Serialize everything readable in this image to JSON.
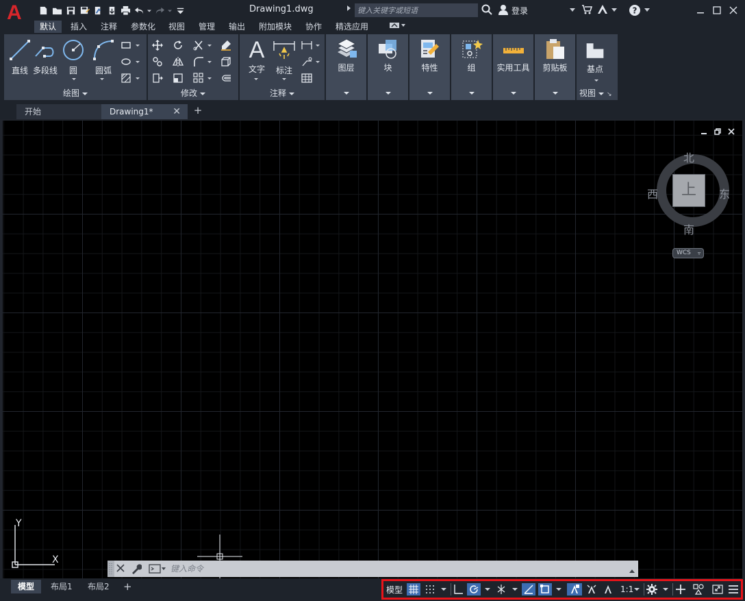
{
  "titlebar": {
    "document_title": "Drawing1.dwg",
    "search_placeholder": "键入关键字或短语",
    "login_label": "登录"
  },
  "ribbon_tabs": [
    {
      "label": "默认",
      "active": true
    },
    {
      "label": "插入"
    },
    {
      "label": "注释"
    },
    {
      "label": "参数化"
    },
    {
      "label": "视图"
    },
    {
      "label": "管理"
    },
    {
      "label": "输出"
    },
    {
      "label": "附加模块"
    },
    {
      "label": "协作"
    },
    {
      "label": "精选应用"
    }
  ],
  "panels": {
    "draw": {
      "title": "绘图",
      "tools": [
        "直线",
        "多段线",
        "圆",
        "圆弧"
      ]
    },
    "modify": {
      "title": "修改"
    },
    "annotation": {
      "title": "注释",
      "tools": [
        "文字",
        "标注"
      ]
    },
    "collapsed": [
      "图层",
      "块",
      "特性",
      "组",
      "实用工具",
      "剪贴板"
    ],
    "view": {
      "title": "视图",
      "tools": [
        "基点"
      ]
    }
  },
  "file_tabs": {
    "start": "开始",
    "current": "Drawing1*",
    "close_glyph": "✕",
    "add_glyph": "+"
  },
  "viewcube": {
    "north": "北",
    "south": "南",
    "west": "西",
    "east": "东",
    "face": "上",
    "wcs": "WCS"
  },
  "ucs": {
    "x": "X",
    "y": "Y"
  },
  "command_line": {
    "placeholder": "键入命令"
  },
  "layout_tabs": [
    "模型",
    "布局1",
    "布局2"
  ],
  "layout_add_glyph": "+",
  "status": {
    "model_label": "模型",
    "scale_label": "1:1"
  }
}
